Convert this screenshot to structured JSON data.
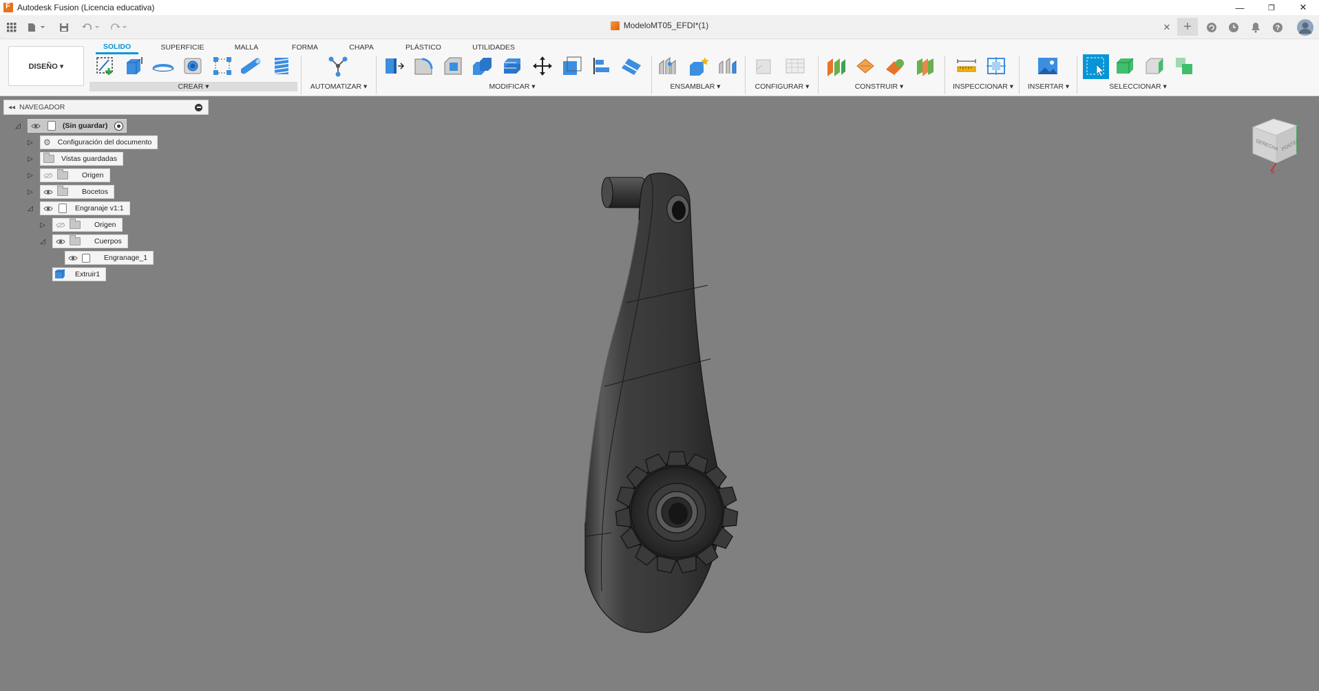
{
  "window": {
    "title": "Autodesk Fusion (Licencia educativa)",
    "minimize": "—",
    "restore": "❐",
    "close": "✕"
  },
  "document": {
    "title": "ModeloMT05_EFDI*(1)",
    "close": "✕"
  },
  "qat": {
    "add": "+"
  },
  "workspace": {
    "label": "DISEÑO ▾"
  },
  "tabs": [
    "SOLIDO",
    "SUPERFICIE",
    "MALLA",
    "FORMA",
    "CHAPA",
    "PLÁSTICO",
    "UTILIDADES"
  ],
  "groups": {
    "crear": "CREAR ▾",
    "automatizar": "AUTOMATIZAR ▾",
    "modificar": "MODIFICAR ▾",
    "ensamblar": "ENSAMBLAR ▾",
    "configurar": "CONFIGURAR ▾",
    "construir": "CONSTRUIR ▾",
    "inspeccionar": "INSPECCIONAR ▾",
    "insertar": "INSERTAR ▾",
    "seleccionar": "SELECCIONAR ▾"
  },
  "navigator": {
    "title": "NAVEGADOR",
    "root": "(Sin guardar)",
    "items": [
      "Configuración del documento",
      "Vistas guardadas",
      "Origen",
      "Bocetos",
      "Engranaje v1:1",
      "Origen",
      "Cuerpos",
      "Engranage_1",
      "Extruir1"
    ]
  },
  "viewcube": {
    "left": "DERECHA",
    "right": "POSTERIOR"
  },
  "colors": {
    "accent": "#0696d7",
    "canvas": "#808080",
    "ribbon": "#f7f7f7"
  }
}
